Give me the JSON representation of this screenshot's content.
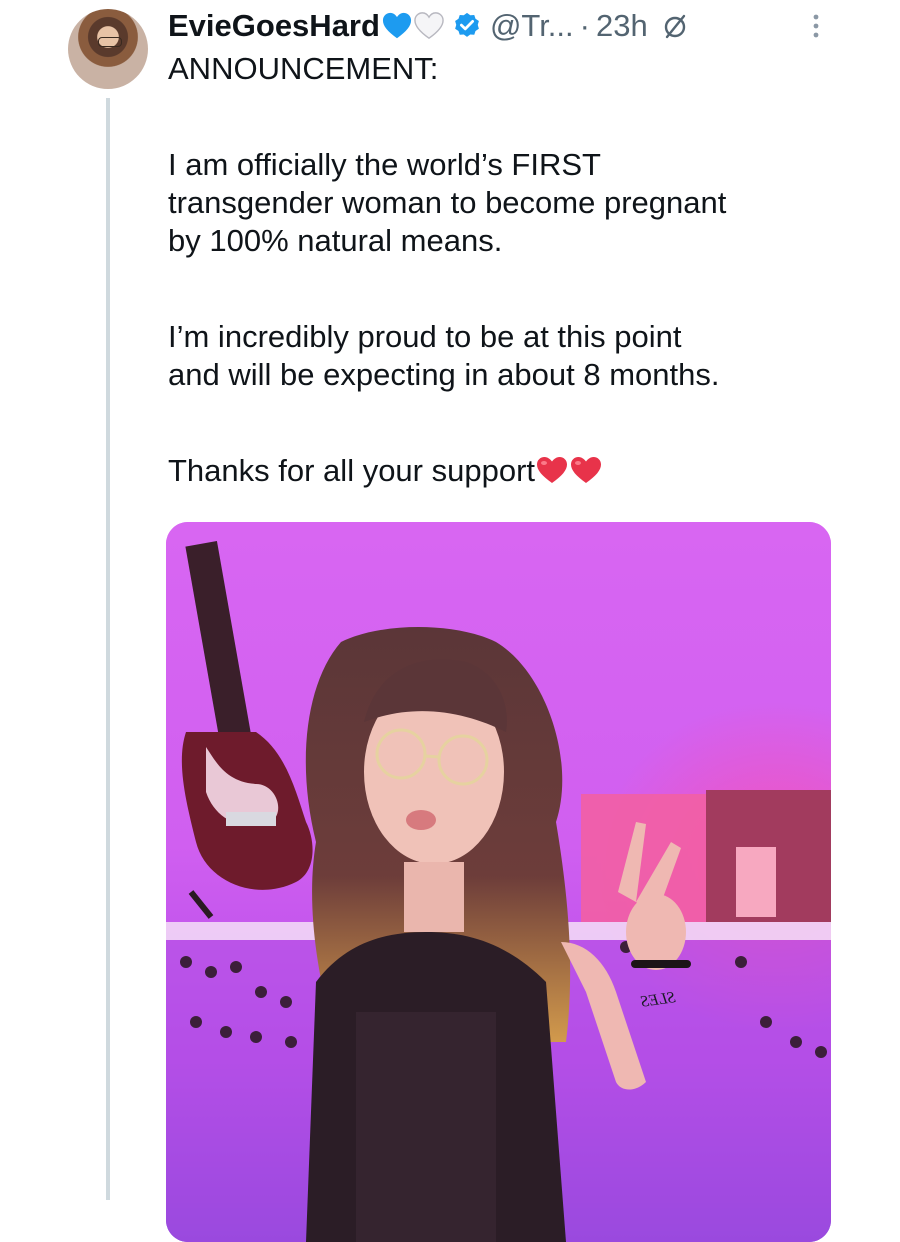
{
  "tweet": {
    "author": {
      "display_name": "EvieGoesHard",
      "name_emojis": [
        "blue-heart",
        "white-heart"
      ],
      "verified": true,
      "handle": "@Tr...",
      "separator": "·",
      "time": "23h"
    },
    "text": {
      "line1": "ANNOUNCEMENT:",
      "para1": [
        "I am officially the world’s FIRST",
        "transgender woman to become pregnant",
        "by 100% natural means."
      ],
      "para2": [
        "I’m incredibly proud to be at this point",
        "and will be expecting in about 8 months."
      ],
      "para3": "Thanks for all your support",
      "para3_emojis": [
        "red-heart",
        "red-heart"
      ]
    },
    "media": {
      "wrist_tattoo_text": "SLES"
    }
  },
  "colors": {
    "text_primary": "#0f1419",
    "text_secondary": "#536471",
    "verified_blue": "#1d9bf0",
    "blue_heart": "#1d9bf0",
    "red_heart": "#e8334a",
    "thread_line": "#cfd9de",
    "photo_background": "#cf52ee"
  },
  "icons": {
    "verified": "verified-badge-icon",
    "no_edit": "circle-slash-icon",
    "more": "vertical-ellipsis-icon"
  }
}
